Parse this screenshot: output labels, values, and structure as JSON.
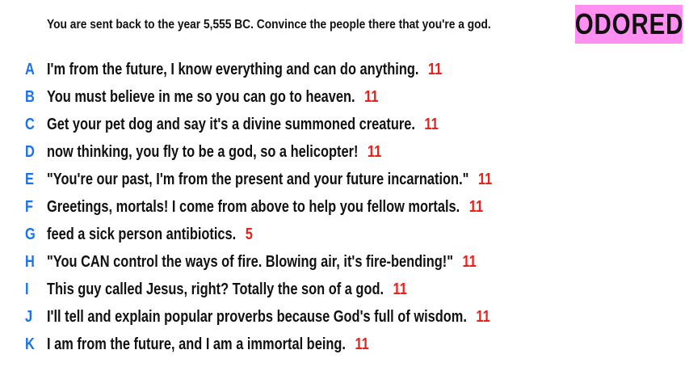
{
  "prompt": "You are sent back to the year 5,555 BC. Convince the people there that you're a god.",
  "badge": {
    "label": "ODORED",
    "color": "#ff8ff0"
  },
  "colors": {
    "letter": "#1a73e8",
    "score": "#e8211b"
  },
  "answers": [
    {
      "letter": "A",
      "text": "I'm from the future, I know everything and can do anything.",
      "score": "11"
    },
    {
      "letter": "B",
      "text": "You must believe in me so you can go to heaven.",
      "score": "11"
    },
    {
      "letter": "C",
      "text": "Get your pet dog and say it's a divine summoned creature.",
      "score": "11"
    },
    {
      "letter": "D",
      "text": "now thinking, you fly to be a god, so a helicopter!",
      "score": "11"
    },
    {
      "letter": "E",
      "text": "\"You're our past, I'm from the present and your future incarnation.\"",
      "score": "11"
    },
    {
      "letter": "F",
      "text": "Greetings, mortals! I come from above to help you fellow mortals.",
      "score": "11"
    },
    {
      "letter": "G",
      "text": "feed a sick person antibiotics.",
      "score": "5"
    },
    {
      "letter": "H",
      "text": "\"You CAN control the ways of fire. Blowing air, it's fire-bending!\"",
      "score": "11"
    },
    {
      "letter": "I",
      "text": "This guy called Jesus, right? Totally the son of a god.",
      "score": "11"
    },
    {
      "letter": "J",
      "text": "I'll tell and explain popular proverbs because God's full of wisdom.",
      "score": "11"
    },
    {
      "letter": "K",
      "text": "I am from the future, and I am a immortal being.",
      "score": "11"
    }
  ]
}
